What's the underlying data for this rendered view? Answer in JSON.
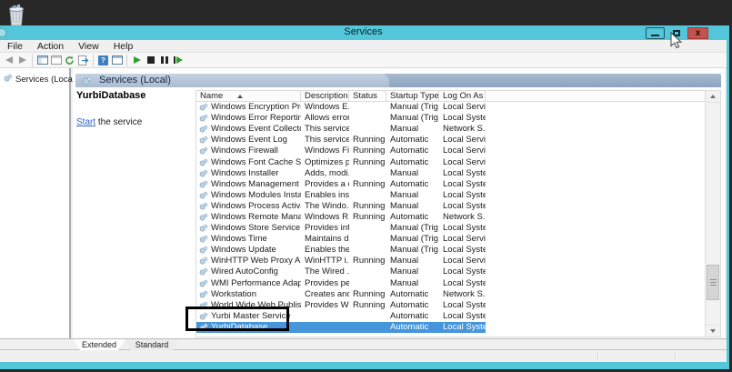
{
  "window": {
    "title": "Services",
    "controls": {
      "minimize": "minimize",
      "maximize": "maximize",
      "close": "x"
    }
  },
  "menu": {
    "items": [
      "File",
      "Action",
      "View",
      "Help"
    ]
  },
  "toolbar": {
    "icons": [
      "back",
      "forward",
      "show-console-tree",
      "properties",
      "refresh",
      "export-list",
      "help",
      "extended-standard-view",
      "start-service",
      "stop-service",
      "pause-service",
      "restart-service"
    ]
  },
  "tree": {
    "items": [
      {
        "label": "Services (Local)"
      }
    ]
  },
  "pane": {
    "title": "Services (Local)",
    "service_name": "YurbiDatabase",
    "action_link_text": "Start",
    "action_suffix": " the service"
  },
  "table": {
    "columns": [
      "Name",
      "Description",
      "Status",
      "Startup Type",
      "Log On As"
    ],
    "rows": [
      {
        "name": "Windows Encryption Provid...",
        "description": "Windows E...",
        "status": "",
        "startup_type": "Manual (Trig...",
        "log_on_as": "Local Service",
        "selected": false
      },
      {
        "name": "Windows Error Reporting Se...",
        "description": "Allows error...",
        "status": "",
        "startup_type": "Manual (Trig...",
        "log_on_as": "Local Syste...",
        "selected": false
      },
      {
        "name": "Windows Event Collector",
        "description": "This service ...",
        "status": "",
        "startup_type": "Manual",
        "log_on_as": "Network S...",
        "selected": false
      },
      {
        "name": "Windows Event Log",
        "description": "This service ...",
        "status": "Running",
        "startup_type": "Automatic",
        "log_on_as": "Local Service",
        "selected": false
      },
      {
        "name": "Windows Firewall",
        "description": "Windows Fi...",
        "status": "Running",
        "startup_type": "Automatic",
        "log_on_as": "Local Service",
        "selected": false
      },
      {
        "name": "Windows Font Cache Service",
        "description": "Optimizes p...",
        "status": "Running",
        "startup_type": "Automatic",
        "log_on_as": "Local Service",
        "selected": false
      },
      {
        "name": "Windows Installer",
        "description": "Adds, modi...",
        "status": "",
        "startup_type": "Manual",
        "log_on_as": "Local Syste...",
        "selected": false
      },
      {
        "name": "Windows Management Inst...",
        "description": "Provides a c...",
        "status": "Running",
        "startup_type": "Automatic",
        "log_on_as": "Local Syste...",
        "selected": false
      },
      {
        "name": "Windows Modules Installer",
        "description": "Enables inst...",
        "status": "",
        "startup_type": "Manual",
        "log_on_as": "Local Syste...",
        "selected": false
      },
      {
        "name": "Windows Process Activatio...",
        "description": "The Windo...",
        "status": "Running",
        "startup_type": "Manual",
        "log_on_as": "Local Syste...",
        "selected": false
      },
      {
        "name": "Windows Remote Manage...",
        "description": "Windows R...",
        "status": "Running",
        "startup_type": "Automatic",
        "log_on_as": "Network S...",
        "selected": false
      },
      {
        "name": "Windows Store Service (WS...",
        "description": "Provides inf...",
        "status": "",
        "startup_type": "Manual (Trig...",
        "log_on_as": "Local Syste...",
        "selected": false
      },
      {
        "name": "Windows Time",
        "description": "Maintains d...",
        "status": "",
        "startup_type": "Manual (Trig...",
        "log_on_as": "Local Service",
        "selected": false
      },
      {
        "name": "Windows Update",
        "description": "Enables the ...",
        "status": "",
        "startup_type": "Manual (Trig...",
        "log_on_as": "Local Syste...",
        "selected": false
      },
      {
        "name": "WinHTTP Web Proxy Auto-...",
        "description": "WinHTTP i...",
        "status": "Running",
        "startup_type": "Manual",
        "log_on_as": "Local Service",
        "selected": false
      },
      {
        "name": "Wired AutoConfig",
        "description": "The Wired ...",
        "status": "",
        "startup_type": "Manual",
        "log_on_as": "Local Syste...",
        "selected": false
      },
      {
        "name": "WMI Performance Adapter",
        "description": "Provides pe...",
        "status": "",
        "startup_type": "Manual",
        "log_on_as": "Local Syste...",
        "selected": false
      },
      {
        "name": "Workstation",
        "description": "Creates and...",
        "status": "Running",
        "startup_type": "Automatic",
        "log_on_as": "Network S...",
        "selected": false
      },
      {
        "name": "World Wide Web Publishin...",
        "description": "Provides W...",
        "status": "Running",
        "startup_type": "Automatic",
        "log_on_as": "Local Syste...",
        "selected": false
      },
      {
        "name": "Yurbi Master Service",
        "description": "",
        "status": "",
        "startup_type": "Automatic",
        "log_on_as": "Local Syste...",
        "selected": false
      },
      {
        "name": "YurbiDatabase",
        "description": "",
        "status": "",
        "startup_type": "Automatic",
        "log_on_as": "Local Syste...",
        "selected": true
      }
    ]
  },
  "tabs": {
    "items": [
      "Extended",
      "Standard"
    ],
    "active": "Extended"
  },
  "colors": {
    "titlebar": "#53c6da",
    "selection": "#4696dc",
    "close_button": "#c4524e",
    "link": "#2a66c9",
    "desktop": "#282828",
    "banner_gradient_top": "#a9bacf",
    "banner_gradient_bottom": "#8ca3c0"
  }
}
